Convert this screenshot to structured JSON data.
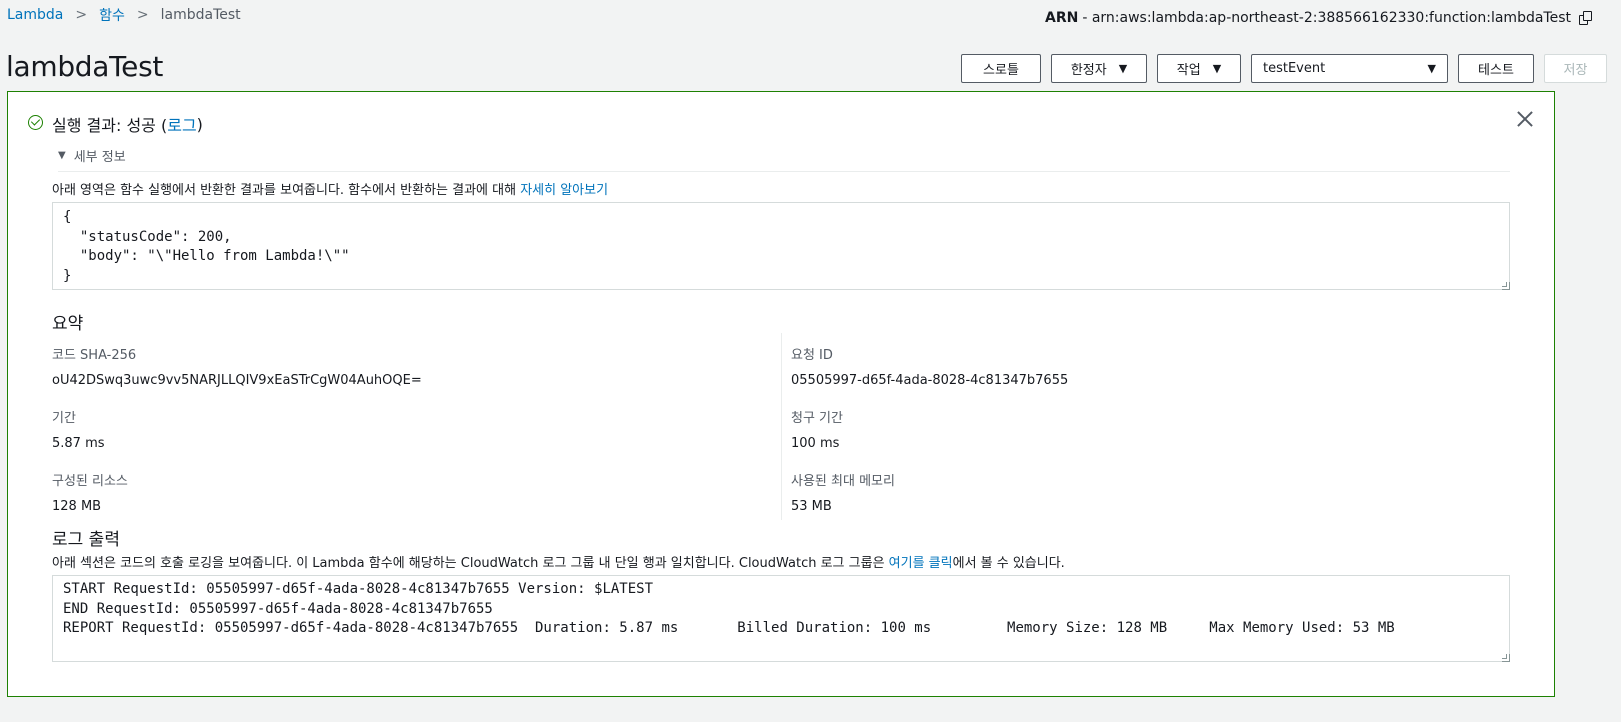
{
  "breadcrumb": {
    "items": [
      "Lambda",
      "함수"
    ],
    "current": "lambdaTest"
  },
  "arn": {
    "label": "ARN",
    "value": "- arn:aws:lambda:ap-northeast-2:388566162330:function:lambdaTest",
    "copy_icon": "copy-icon"
  },
  "page_title": "lambdaTest",
  "actions": {
    "throttle": "스로틀",
    "qualifier": "한정자",
    "actions_menu": "작업",
    "event_select": "testEvent",
    "test": "테스트",
    "save": "저장"
  },
  "result": {
    "status_prefix": "실행 결과: 성공 (",
    "log_link": "로그",
    "status_suffix": ")",
    "details_toggle": "세부 정보",
    "description": "아래 영역은 함수 실행에서 반환한 결과를 보여줍니다. 함수에서 반환하는 결과에 대해 ",
    "learn_more": "자세히 알아보기",
    "output": "{\n  \"statusCode\": 200,\n  \"body\": \"\\\"Hello from Lambda!\\\"\"\n}"
  },
  "summary": {
    "heading": "요약",
    "sha_label": "코드 SHA-256",
    "sha_value": "oU42DSwq3uwc9vv5NARJLLQIV9xEaSTrCgW04AuhOQE=",
    "request_id_label": "요청 ID",
    "request_id_value": "05505997-d65f-4ada-8028-4c81347b7655",
    "duration_label": "기간",
    "duration_value": "5.87 ms",
    "billed_label": "청구 기간",
    "billed_value": "100 ms",
    "resources_label": "구성된 리소스",
    "resources_value": "128 MB",
    "max_memory_label": "사용된 최대 메모리",
    "max_memory_value": "53 MB"
  },
  "log_output": {
    "heading": "로그 출력",
    "description_prefix": "아래 섹션은 코드의 호출 로깅을 보여줍니다. 이 Lambda 함수에 해당하는 CloudWatch 로그 그룹 내 단일 행과 일치합니다. CloudWatch 로그 그룹은 ",
    "click_here": "여기를 클릭",
    "description_suffix": "에서 볼 수 있습니다.",
    "lines": "START RequestId: 05505997-d65f-4ada-8028-4c81347b7655 Version: $LATEST\nEND RequestId: 05505997-d65f-4ada-8028-4c81347b7655\nREPORT RequestId: 05505997-d65f-4ada-8028-4c81347b7655  Duration: 5.87 ms       Billed Duration: 100 ms         Memory Size: 128 MB     Max Memory Used: 53 MB"
  },
  "colors": {
    "success": "#1d8102",
    "link": "#0073bb",
    "background": "#f2f3f3"
  }
}
